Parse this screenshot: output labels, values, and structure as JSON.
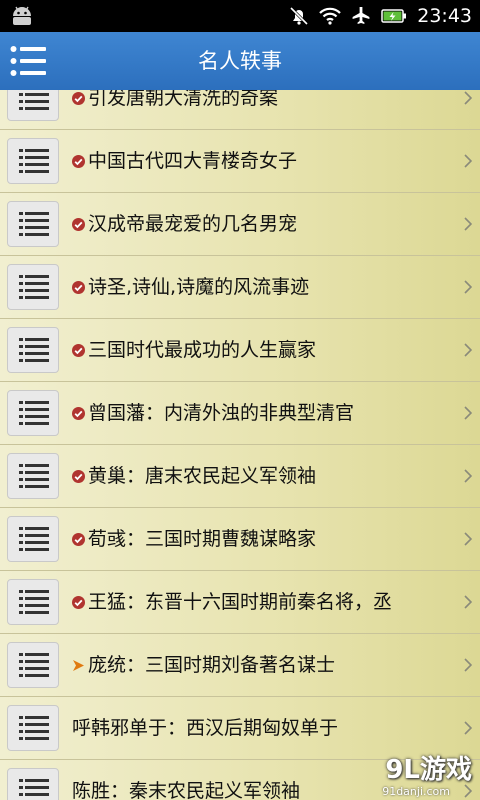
{
  "status_bar": {
    "time": "23:43"
  },
  "header": {
    "title": "名人轶事"
  },
  "list": [
    {
      "text": "引发唐朝大清洗的奇案",
      "mark": "check"
    },
    {
      "text": "中国古代四大青楼奇女子",
      "mark": "check"
    },
    {
      "text": "汉成帝最宠爱的几名男宠",
      "mark": "check"
    },
    {
      "text": "诗圣,诗仙,诗魔的风流事迹",
      "mark": "check"
    },
    {
      "text": "三国时代最成功的人生赢家",
      "mark": "check"
    },
    {
      "text": " 曾国藩：内清外浊的非典型清官",
      "mark": "check"
    },
    {
      "text": "黄巢：唐末农民起义军领袖",
      "mark": "check"
    },
    {
      "text": "荀彧：三国时期曹魏谋略家",
      "mark": "check"
    },
    {
      "text": "王猛：东晋十六国时期前秦名将，丞",
      "mark": "check"
    },
    {
      "text": "庞统：三国时期刘备著名谋士",
      "mark": "arrow"
    },
    {
      "text": "呼韩邪单于：西汉后期匈奴单于",
      "mark": "none"
    },
    {
      "text": "陈胜：秦末农民起义军领袖",
      "mark": "none"
    }
  ],
  "watermark": {
    "brand": "9L游戏",
    "url": "91danji.com"
  },
  "colors": {
    "header": "#3a7fcc",
    "check": "#b0342f",
    "arrow": "#e07a10"
  }
}
